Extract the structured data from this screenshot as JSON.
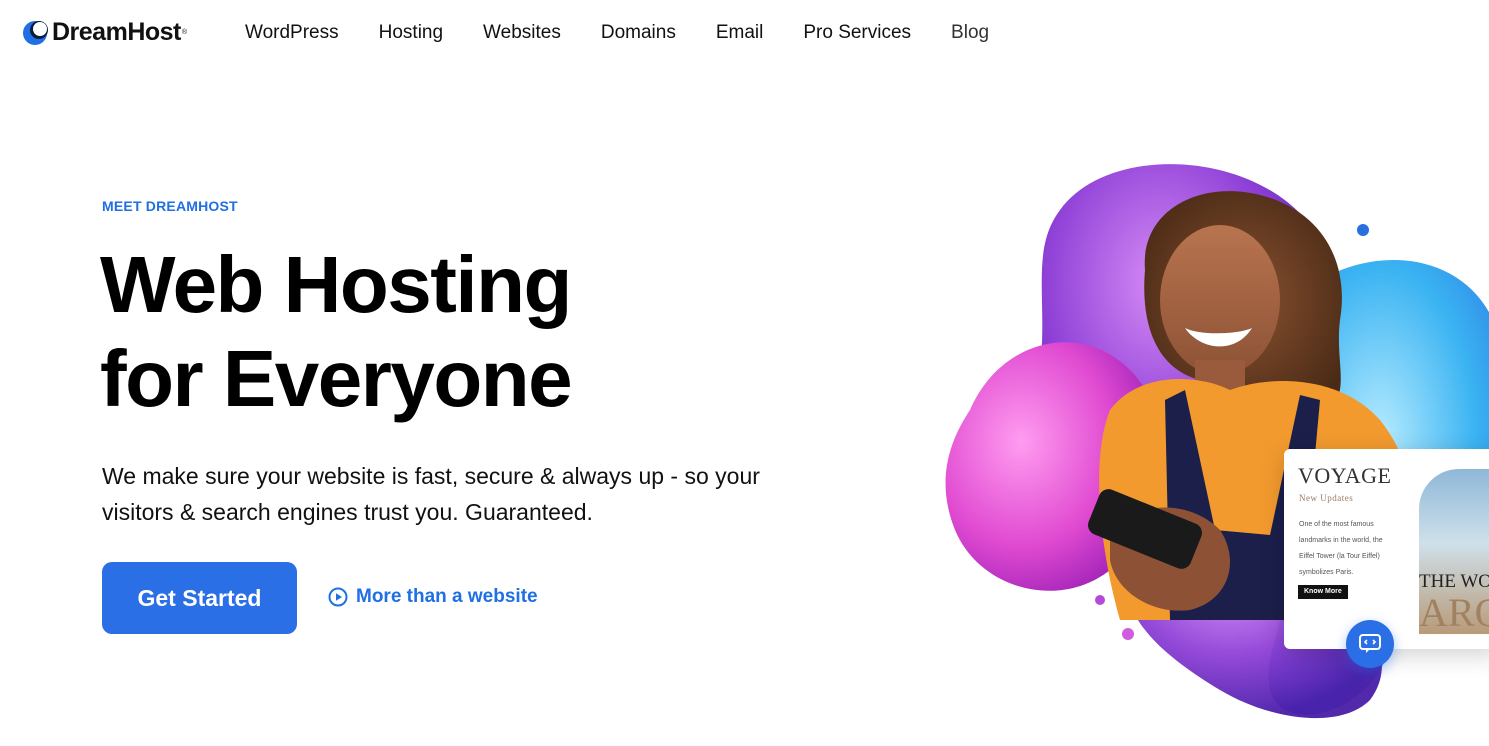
{
  "brand": {
    "name": "DreamHost",
    "reg": "®",
    "color": "#1f6fe5"
  },
  "nav": {
    "items": [
      {
        "label": "WordPress"
      },
      {
        "label": "Hosting"
      },
      {
        "label": "Websites"
      },
      {
        "label": "Domains"
      },
      {
        "label": "Email"
      },
      {
        "label": "Pro Services"
      },
      {
        "label": "Blog"
      }
    ]
  },
  "hero": {
    "eyebrow": "MEET DREAMHOST",
    "headline_line1": "Web Hosting",
    "headline_line2": "for Everyone",
    "subtext": "We make sure your website is fast, secure & always up - so your visitors & search engines trust you. Guaranteed.",
    "primary_cta": "Get Started",
    "secondary_cta": "More than a website",
    "secondary_icon": "play-circle-icon"
  },
  "preview_card": {
    "title": "VOYAGE",
    "subtitle": "New Updates",
    "body": "One of the most famous landmarks in the world, the Eiffel Tower (la Tour Eiffel) symbolizes Paris.",
    "button": "Know More",
    "headline_fragment_1": "THE WO",
    "headline_fragment_2": "ARO"
  },
  "chat": {
    "icon": "code-chat-icon"
  },
  "colors": {
    "accent": "#2b6fe6",
    "text": "#111111",
    "blob_purple": "#a24bd9",
    "blob_blue": "#3fb6f0",
    "blob_pink": "#e24fd4",
    "sweater": "#f29a2e"
  }
}
